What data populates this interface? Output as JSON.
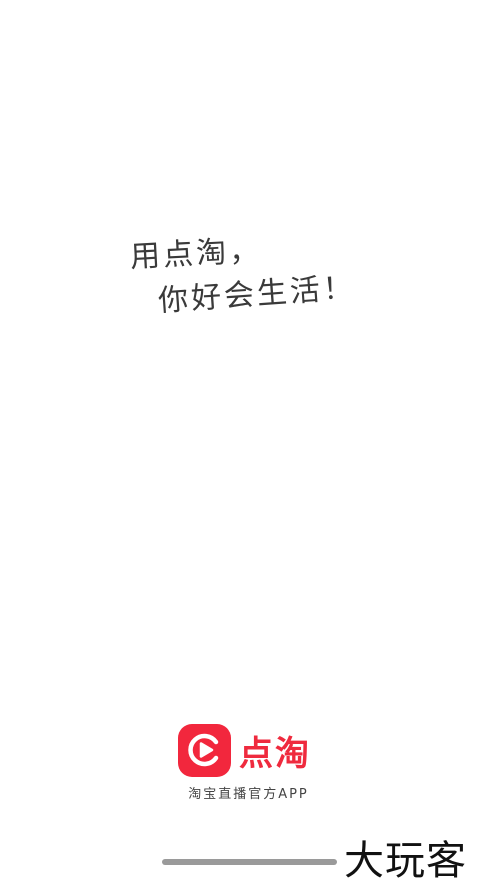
{
  "slogan": {
    "line1": "用点淘，",
    "line2": "你好会生活！"
  },
  "brand": {
    "icon": "dian-tao-play-icon",
    "name": "点淘",
    "tagline": "淘宝直播官方APP",
    "color": "#f2273d"
  },
  "watermark": {
    "text": "大玩客"
  }
}
